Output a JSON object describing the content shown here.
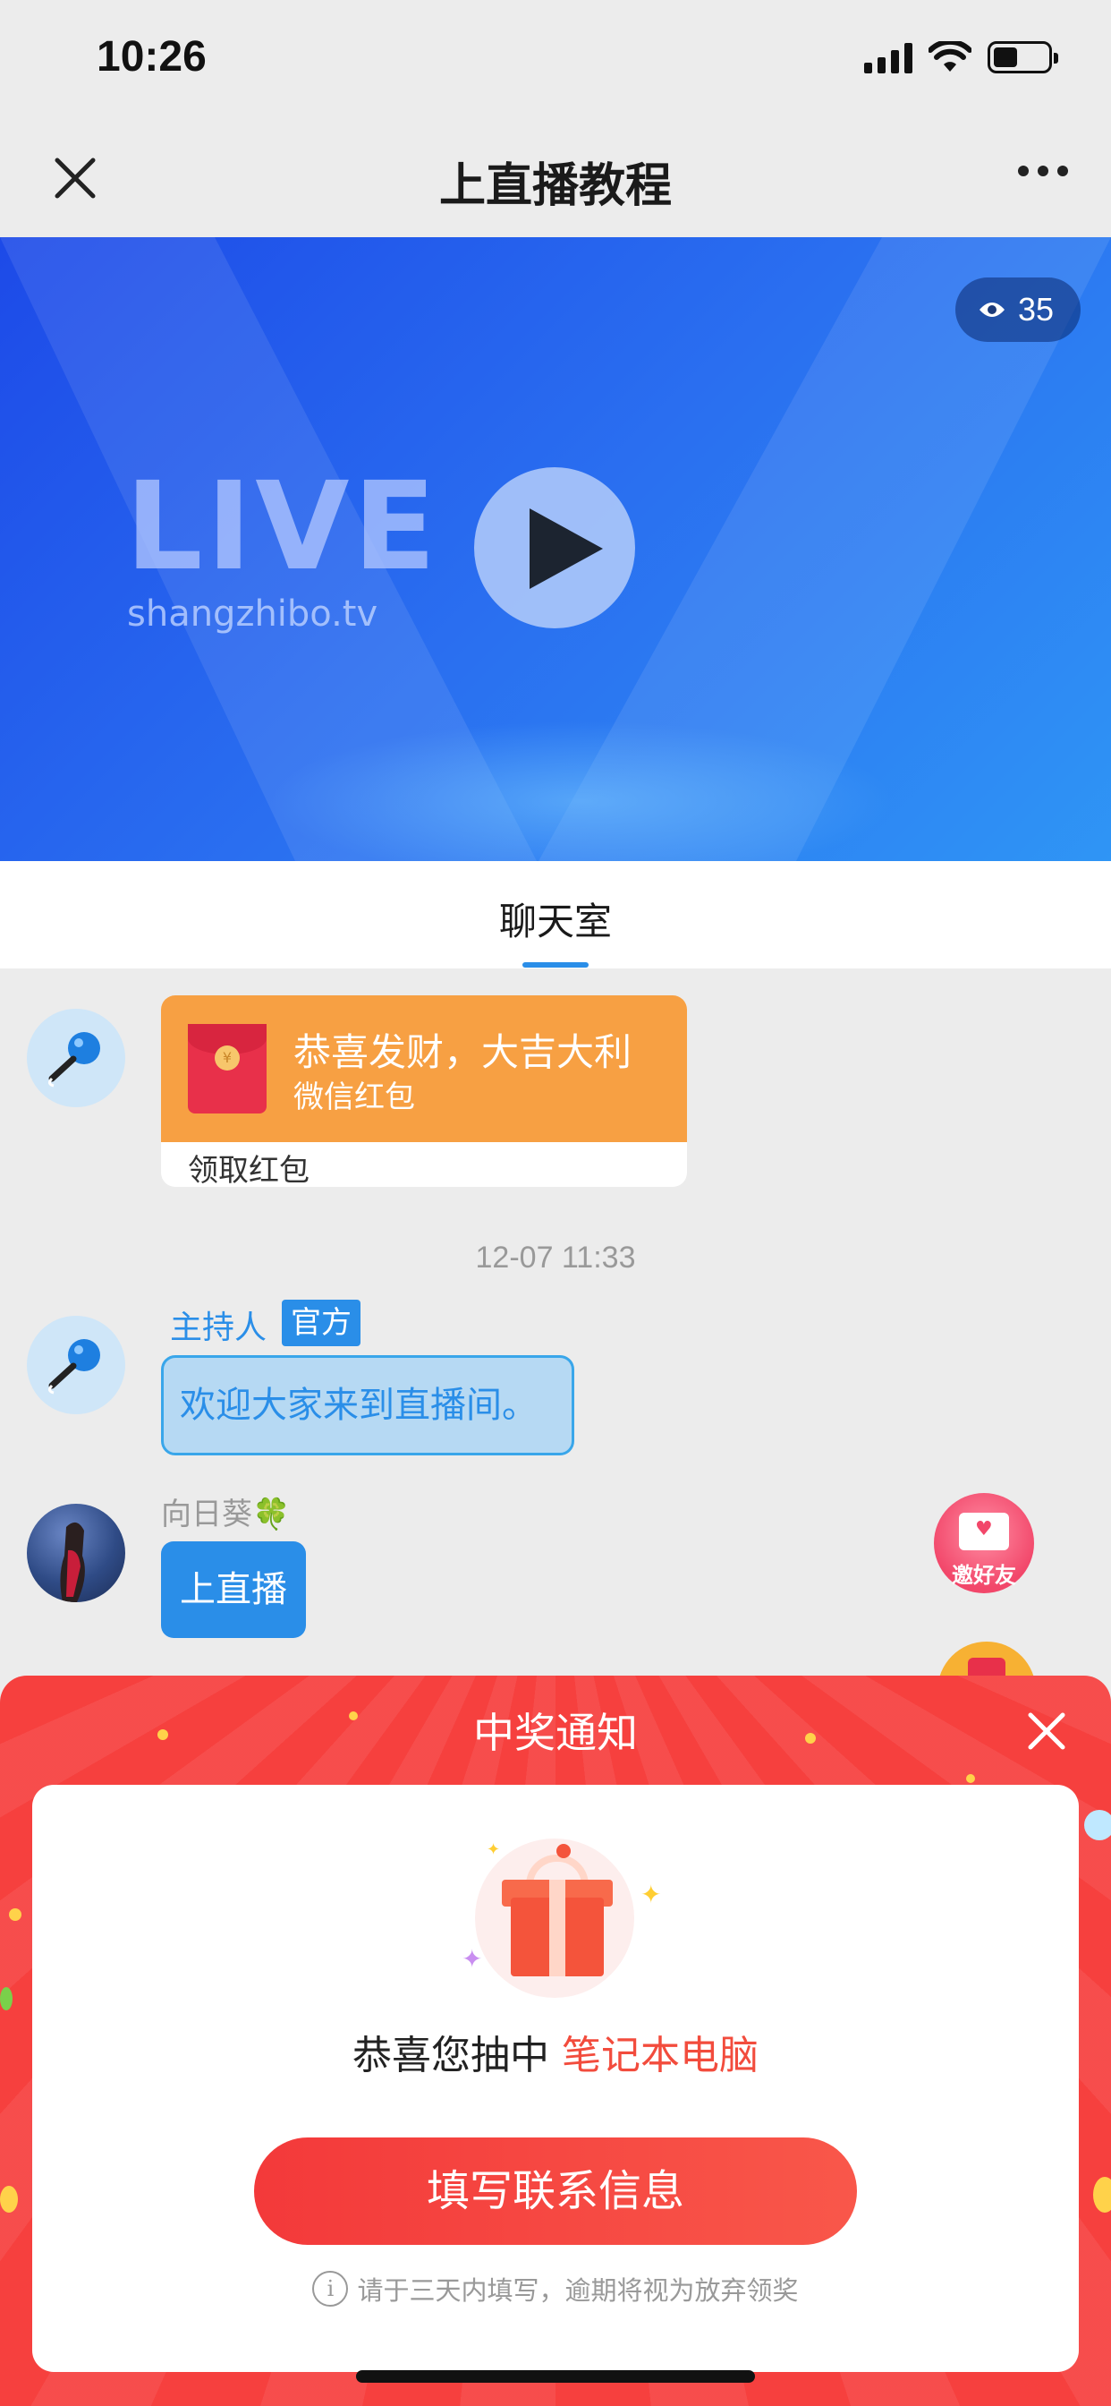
{
  "status": {
    "time": "10:26"
  },
  "nav": {
    "title": "上直播教程"
  },
  "video": {
    "views": "35",
    "live_logo": "LIVE",
    "live_domain": "shangzhibo.tv"
  },
  "tabs": [
    {
      "label": "聊天室",
      "active": true
    }
  ],
  "chat": {
    "red_packet": {
      "title": "恭喜发财，大吉大利",
      "subtitle": "微信红包",
      "action": "领取红包"
    },
    "timestamp": "12-07 11:33",
    "host_message": {
      "name": "主持人",
      "tag": "官方",
      "text": "欢迎大家来到直播间。"
    },
    "user_message": {
      "name": "向日葵🍀",
      "text": "上直播"
    },
    "invite_label": "邀好友"
  },
  "prize_sheet": {
    "title": "中奖通知",
    "win_prefix": "恭喜您抽中",
    "prize": "笔记本电脑",
    "button": "填写联系信息",
    "hint": "请于三天内填写，逾期将视为放弃领奖"
  },
  "colors": {
    "accent_blue": "#2a8ee8",
    "sheet_red": "#f6403e",
    "red_packet_orange": "#f7a043"
  }
}
